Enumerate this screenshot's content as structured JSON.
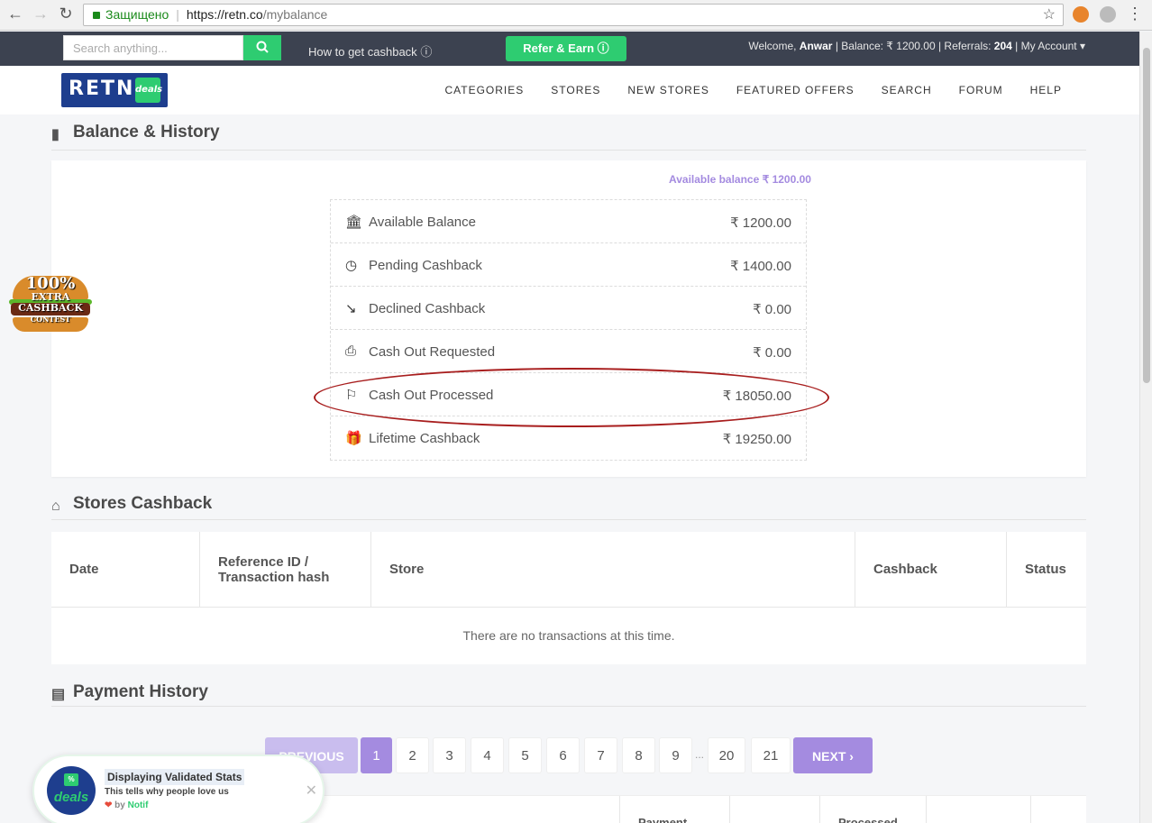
{
  "browser": {
    "secure_label": "Защищено",
    "url_host": "https://retn.co",
    "url_path": "/mybalance"
  },
  "topbar": {
    "search_placeholder": "Search anything...",
    "how_to": "How to get cashback",
    "refer": "Refer & Earn",
    "welcome_prefix": "Welcome, ",
    "user_name": "Anwar",
    "balance_text": " | Balance: ₹ 1200.00 | Referrals: ",
    "referrals": "204",
    "account": " | My Account"
  },
  "header": {
    "logo_text": "RETN",
    "logo_tag": "deals",
    "nav": [
      "CATEGORIES",
      "STORES",
      "NEW STORES",
      "FEATURED OFFERS",
      "SEARCH",
      "FORUM",
      "HELP"
    ]
  },
  "balance": {
    "title": "Balance & History",
    "available_label": "Available balance ₹ 1200.00",
    "rows": [
      {
        "label": "Available Balance",
        "amount": "₹ 1200.00",
        "icon": "bank-icon"
      },
      {
        "label": "Pending Cashback",
        "amount": "₹ 1400.00",
        "icon": "clock-icon"
      },
      {
        "label": "Declined Cashback",
        "amount": "₹ 0.00",
        "icon": "trend-down-icon"
      },
      {
        "label": "Cash Out Requested",
        "amount": "₹ 0.00",
        "icon": "printer-icon"
      },
      {
        "label": "Cash Out Processed",
        "amount": "₹ 18050.00",
        "icon": "signpost-icon"
      },
      {
        "label": "Lifetime Cashback",
        "amount": "₹ 19250.00",
        "icon": "gift-icon"
      }
    ]
  },
  "promo": {
    "big": "100%",
    "line1": "EXTRA",
    "line2": "CASHBACK",
    "line3": "CONTEST"
  },
  "stores": {
    "title": "Stores Cashback",
    "headers": [
      "Date",
      "Reference ID / Transaction hash",
      "Store",
      "Cashback",
      "Status"
    ],
    "empty": "There are no transactions at this time."
  },
  "payments": {
    "title": "Payment History",
    "headers": [
      "Payment",
      "Processed"
    ]
  },
  "pagination": {
    "prev": "PREVIOUS",
    "pages": [
      "1",
      "2",
      "3",
      "4",
      "5",
      "6",
      "7",
      "8",
      "9"
    ],
    "ellipsis": "...",
    "tail_pages": [
      "20",
      "21"
    ],
    "next": "NEXT ›",
    "current": "1"
  },
  "notif": {
    "avatar_text": "deals",
    "title": "Displaying Validated Stats",
    "subtitle": "This tells why people love us",
    "by": "by",
    "brand": "Notif"
  },
  "colors": {
    "accent_green": "#2ecc71",
    "accent_purple": "#a48be0",
    "topbar": "#3c4250",
    "highlight_red": "#a81e1e"
  }
}
